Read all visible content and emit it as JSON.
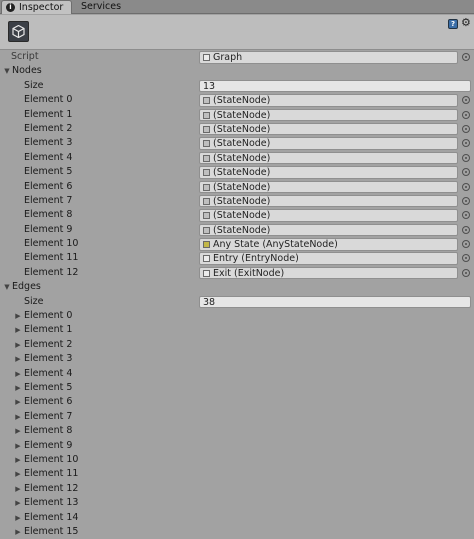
{
  "tabs": [
    {
      "label": "Inspector",
      "active": true
    },
    {
      "label": "Services",
      "active": false
    }
  ],
  "script": {
    "label": "Script",
    "value": "Graph"
  },
  "nodes": {
    "label": "Nodes",
    "size_label": "Size",
    "size": "13",
    "items": [
      {
        "label": "Element 0",
        "value": "(StateNode)",
        "icon": "state"
      },
      {
        "label": "Element 1",
        "value": "(StateNode)",
        "icon": "state"
      },
      {
        "label": "Element 2",
        "value": "(StateNode)",
        "icon": "state"
      },
      {
        "label": "Element 3",
        "value": "(StateNode)",
        "icon": "state"
      },
      {
        "label": "Element 4",
        "value": "(StateNode)",
        "icon": "state"
      },
      {
        "label": "Element 5",
        "value": "(StateNode)",
        "icon": "state"
      },
      {
        "label": "Element 6",
        "value": "(StateNode)",
        "icon": "state"
      },
      {
        "label": "Element 7",
        "value": "(StateNode)",
        "icon": "state"
      },
      {
        "label": "Element 8",
        "value": "(StateNode)",
        "icon": "state"
      },
      {
        "label": "Element 9",
        "value": "(StateNode)",
        "icon": "state"
      },
      {
        "label": "Element 10",
        "value": "Any State (AnyStateNode)",
        "icon": "yellow"
      },
      {
        "label": "Element 11",
        "value": "Entry (EntryNode)",
        "icon": "empty"
      },
      {
        "label": "Element 12",
        "value": "Exit (ExitNode)",
        "icon": "empty"
      }
    ]
  },
  "edges": {
    "label": "Edges",
    "size_label": "Size",
    "size": "38",
    "items": [
      "Element 0",
      "Element 1",
      "Element 2",
      "Element 3",
      "Element 4",
      "Element 5",
      "Element 6",
      "Element 7",
      "Element 8",
      "Element 9",
      "Element 10",
      "Element 11",
      "Element 12",
      "Element 13",
      "Element 14",
      "Element 15"
    ]
  },
  "icons": {
    "tab_info": "info-icon",
    "component": "unity-logo-icon",
    "help": "help-book-icon",
    "settings": "gear-icon",
    "picker": "object-picker-icon",
    "foldout": "foldout-triangle-icon"
  }
}
